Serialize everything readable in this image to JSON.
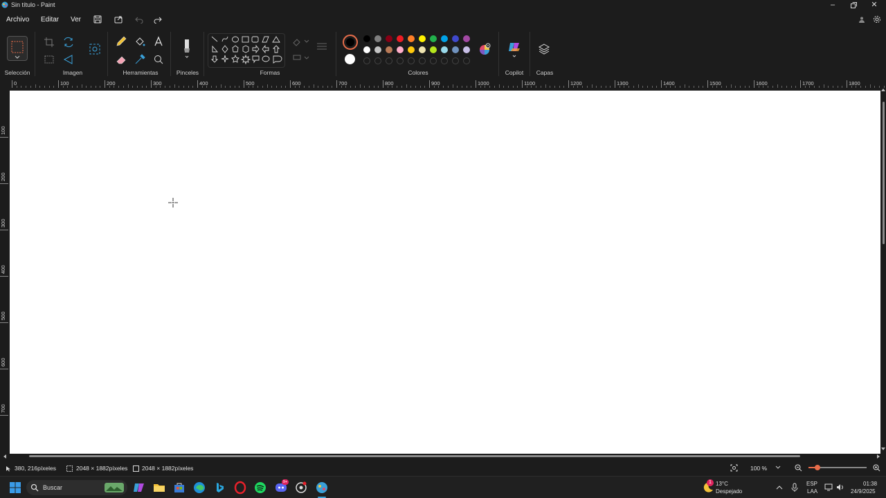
{
  "window": {
    "title": "Sin título - Paint"
  },
  "menus": [
    "Archivo",
    "Editar",
    "Ver"
  ],
  "ribbon": {
    "groups": {
      "selection": "Selección",
      "image": "Imagen",
      "tools": "Herramientas",
      "brushes": "Pinceles",
      "shapes": "Formas",
      "colors": "Colores",
      "copilot": "Copilot",
      "layers": "Capas"
    },
    "palette_row1": [
      "#000000",
      "#7f7f7f",
      "#880015",
      "#ed1c24",
      "#ff7f27",
      "#fff200",
      "#22b14c",
      "#00a2e8",
      "#3f48cc",
      "#a349a4"
    ],
    "palette_row2": [
      "#ffffff",
      "#c3c3c3",
      "#b97a57",
      "#ffaec9",
      "#ffc90e",
      "#efe4b0",
      "#b5e61d",
      "#99d9ea",
      "#7092be",
      "#c8bfe7"
    ],
    "primary_color": "#000000",
    "secondary_color": "#ffffff"
  },
  "ruler": {
    "h_labels": [
      "0",
      "100",
      "200",
      "300",
      "400",
      "500",
      "600",
      "700",
      "800",
      "900",
      "1000",
      "1100",
      "1200",
      "1300",
      "1400",
      "1500",
      "1600",
      "1700",
      "1800"
    ],
    "v_labels": [
      "100",
      "200",
      "300",
      "400",
      "500",
      "600",
      "700"
    ]
  },
  "status": {
    "cursor_pos": "380, 216píxeles",
    "selection_size": "2048 × 1882píxeles",
    "canvas_size": "2048 × 1882píxeles",
    "zoom": "100 %"
  },
  "taskbar": {
    "search_placeholder": "Buscar",
    "weather_temp": "13°C",
    "weather_desc": "Despejado",
    "weather_badge": "1",
    "lang_top": "ESP",
    "lang_bottom": "LAA",
    "time": "01:38",
    "date": "24/9/2025",
    "discord_badge": "9+"
  }
}
